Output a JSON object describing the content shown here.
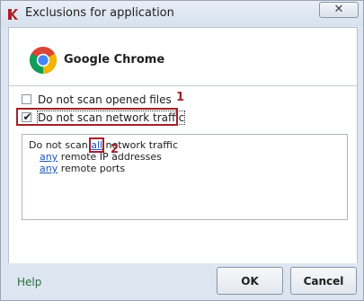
{
  "window": {
    "title": "Exclusions for application",
    "close_glyph": "✕",
    "icon": "kaspersky-k-icon"
  },
  "app": {
    "name": "Google Chrome",
    "icon": "chrome-icon"
  },
  "options": [
    {
      "label": "Do not scan opened files",
      "checked": false
    },
    {
      "label": "Do not scan network traffic",
      "checked": true
    }
  ],
  "markers": {
    "one": "1",
    "two": "2"
  },
  "rules": {
    "line1_prefix": "Do not scan ",
    "line1_link": "all",
    "line1_suffix": " network traffic",
    "line2_link": "any",
    "line2_suffix": " remote IP addresses",
    "line3_link": "any",
    "line3_suffix": " remote ports"
  },
  "footer": {
    "help": "Help",
    "ok": "OK",
    "cancel": "Cancel"
  },
  "colors": {
    "highlight": "#a0212b",
    "link": "#1a56c0",
    "help": "#2c6e3f"
  }
}
